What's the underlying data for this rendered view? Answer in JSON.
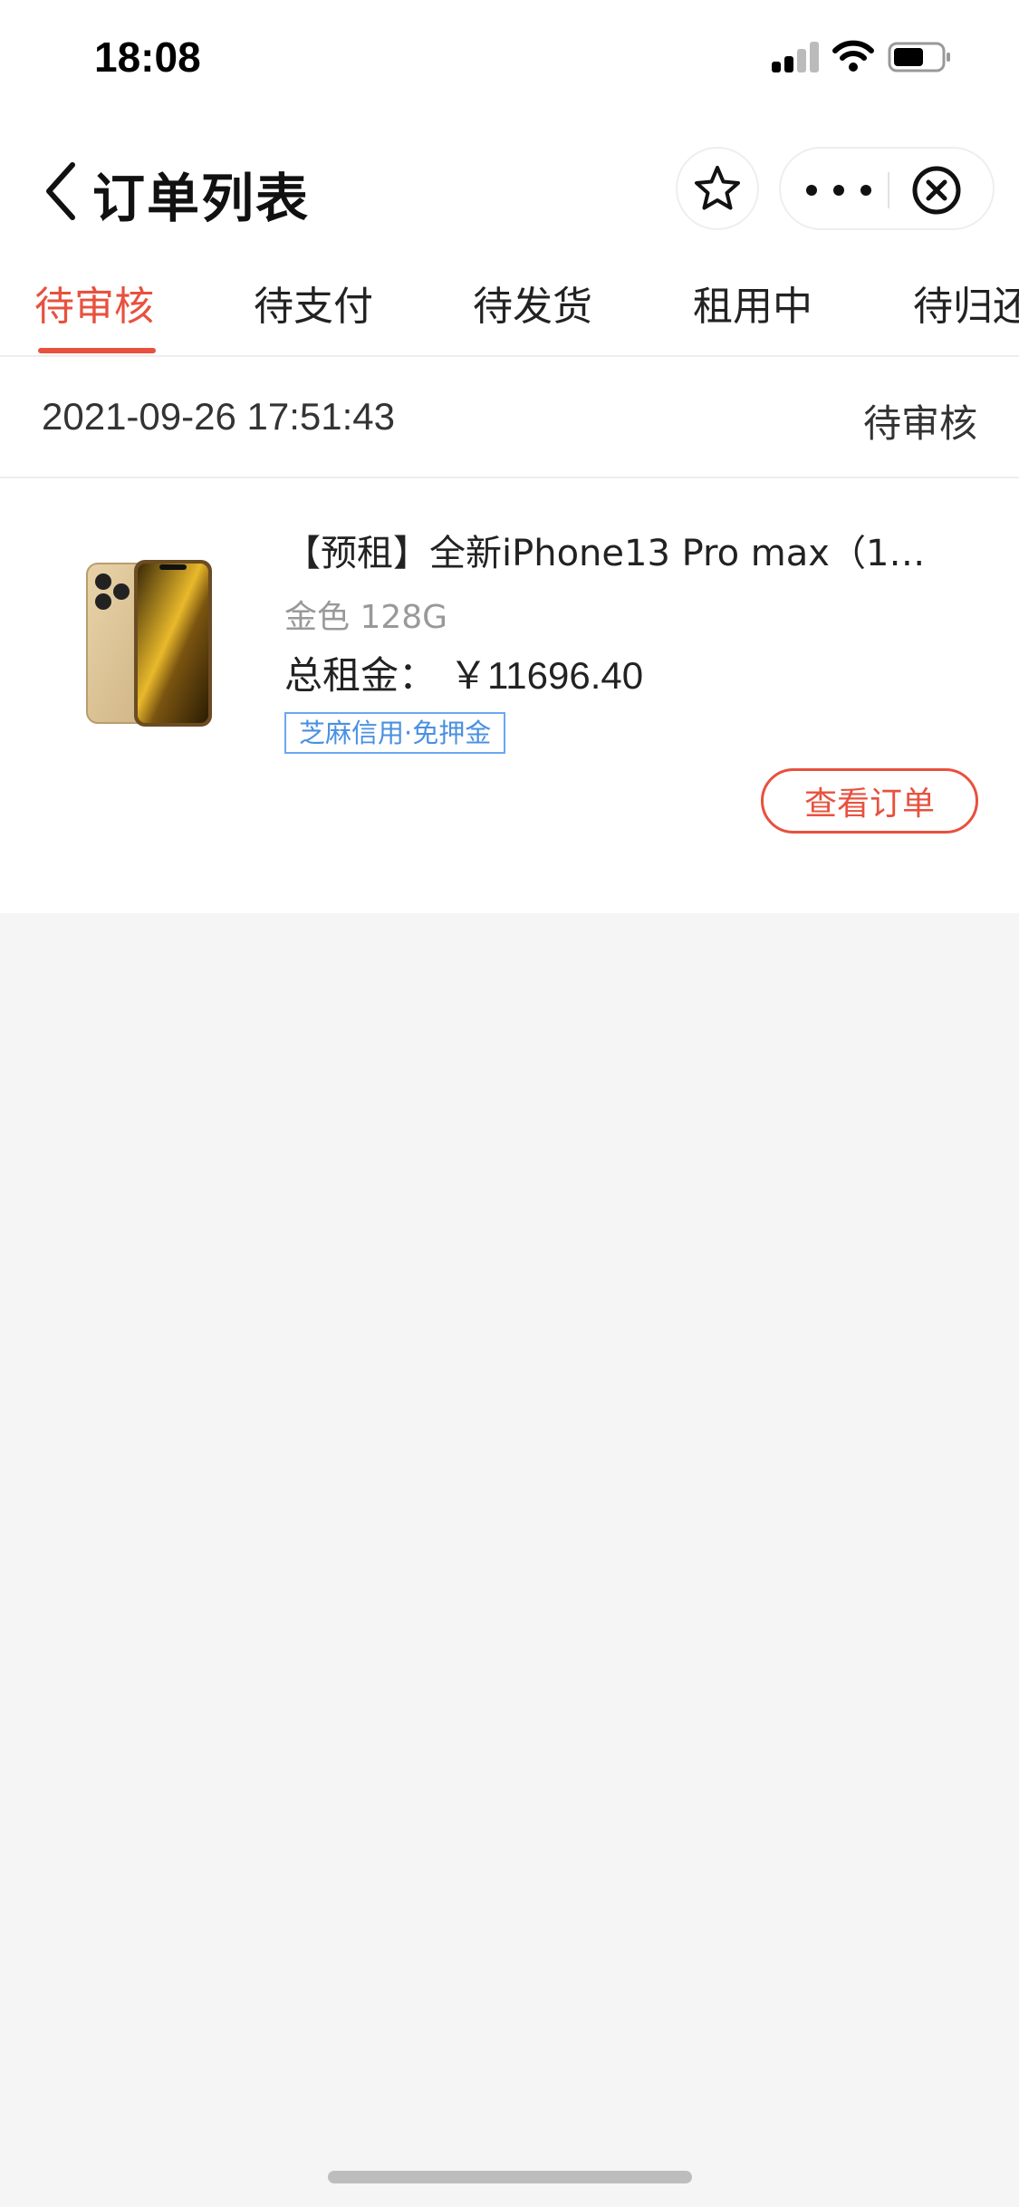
{
  "status_bar": {
    "time": "18:08"
  },
  "header": {
    "title": "订单列表"
  },
  "tabs": [
    {
      "label": "待审核",
      "active": true
    },
    {
      "label": "待支付",
      "active": false
    },
    {
      "label": "待发货",
      "active": false
    },
    {
      "label": "租用中",
      "active": false
    },
    {
      "label": "待归还",
      "active": false
    }
  ],
  "order": {
    "datetime": "2021-09-26 17:51:43",
    "status": "待审核",
    "product_name": "【预租】全新iPhone13 Pro max（10...",
    "spec": "金色 128G",
    "rent_label": "总租金：",
    "rent_value": "￥11696.40",
    "tag": "芝麻信用·免押金",
    "view_button": "查看订单"
  },
  "colors": {
    "accent": "#e8513e",
    "tag_blue": "#4a90e2",
    "background": "#f5f5f5"
  }
}
